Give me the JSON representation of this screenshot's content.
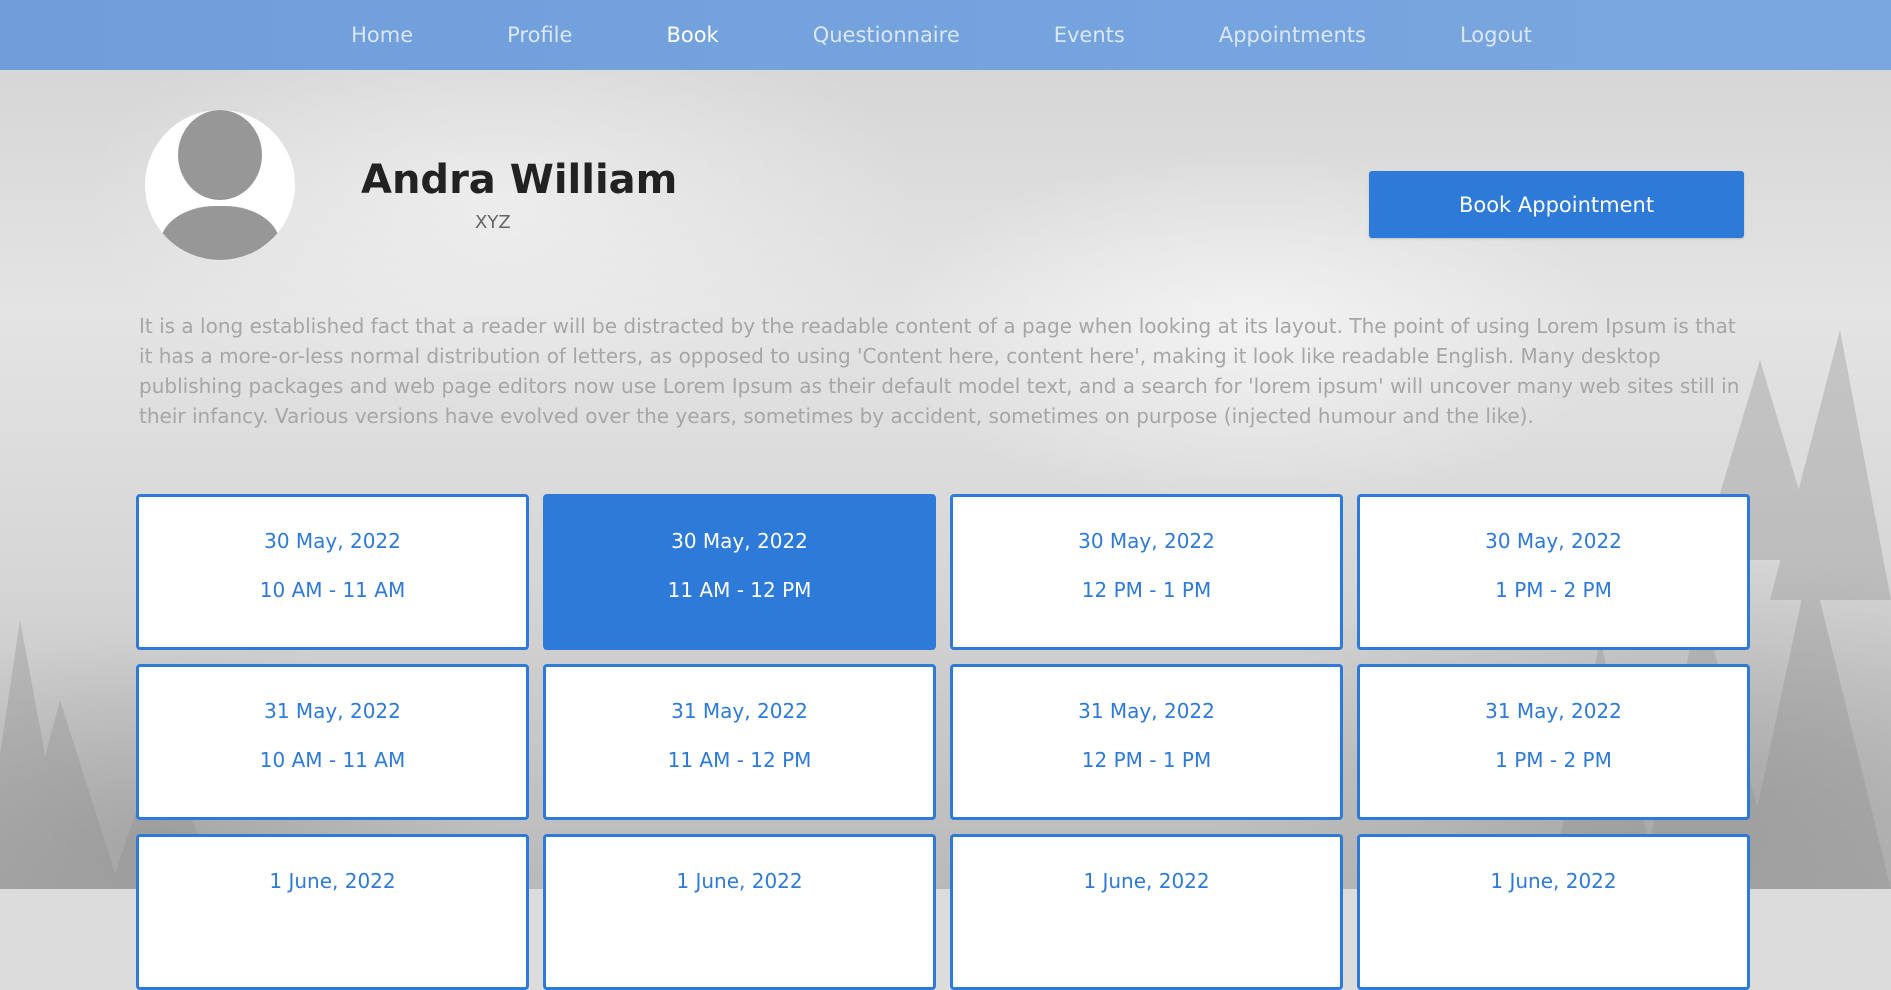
{
  "nav": {
    "items": [
      {
        "label": "Home",
        "active": false
      },
      {
        "label": "Profile",
        "active": false
      },
      {
        "label": "Book",
        "active": true
      },
      {
        "label": "Questionnaire",
        "active": false
      },
      {
        "label": "Events",
        "active": false
      },
      {
        "label": "Appointments",
        "active": false
      },
      {
        "label": "Logout",
        "active": false
      }
    ]
  },
  "profile": {
    "name": "Andra William",
    "subtitle": "XYZ",
    "avatar_icon": "user-avatar-icon"
  },
  "actions": {
    "book_label": "Book Appointment"
  },
  "description": "It is a long established fact that a reader will be distracted by the readable content of a page when looking at its layout. The point of using Lorem Ipsum is that it has a more-or-less normal distribution of letters, as opposed to using 'Content here, content here', making it look like readable English. Many desktop publishing packages and web page editors now use Lorem Ipsum as their default model text, and a search for 'lorem ipsum' will uncover many web sites still in their infancy. Various versions have evolved over the years, sometimes by accident, sometimes on purpose (injected humour and the like).",
  "slots": [
    {
      "date": "30 May, 2022",
      "time": "10 AM - 11 AM",
      "selected": false
    },
    {
      "date": "30 May, 2022",
      "time": "11 AM - 12 PM",
      "selected": true
    },
    {
      "date": "30 May, 2022",
      "time": "12 PM - 1 PM",
      "selected": false
    },
    {
      "date": "30 May, 2022",
      "time": "1 PM - 2 PM",
      "selected": false
    },
    {
      "date": "31 May, 2022",
      "time": "10 AM - 11 AM",
      "selected": false
    },
    {
      "date": "31 May, 2022",
      "time": "11 AM - 12 PM",
      "selected": false
    },
    {
      "date": "31 May, 2022",
      "time": "12 PM - 1 PM",
      "selected": false
    },
    {
      "date": "31 May, 2022",
      "time": "1 PM - 2 PM",
      "selected": false
    },
    {
      "date": "1 June, 2022",
      "time": "",
      "selected": false
    },
    {
      "date": "1 June, 2022",
      "time": "",
      "selected": false
    },
    {
      "date": "1 June, 2022",
      "time": "",
      "selected": false
    },
    {
      "date": "1 June, 2022",
      "time": "",
      "selected": false
    }
  ],
  "colors": {
    "accent": "#2e7ad8",
    "nav_bg": "#7aa7df",
    "background": "#dcdcdc"
  }
}
